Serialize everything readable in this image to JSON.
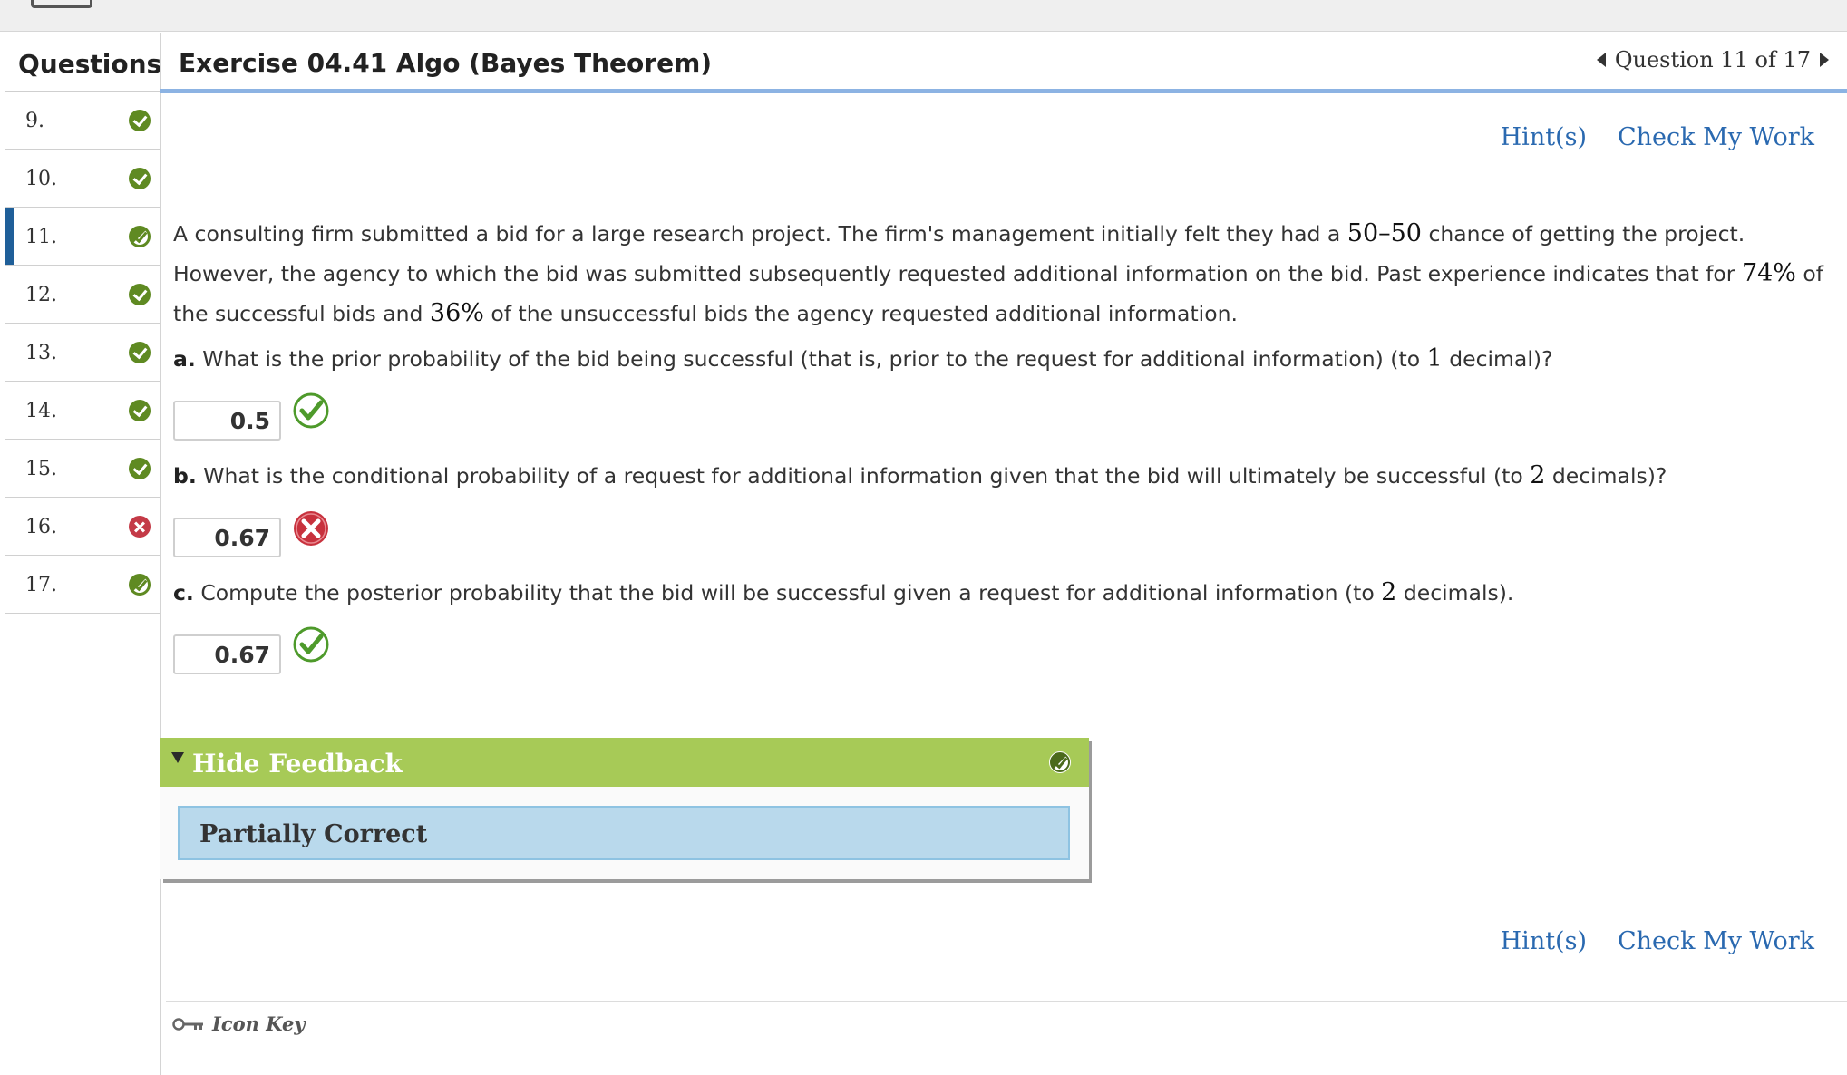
{
  "sidebar": {
    "header": "Questions",
    "items": [
      {
        "num": "9.",
        "status": "correct"
      },
      {
        "num": "10.",
        "status": "correct"
      },
      {
        "num": "11.",
        "status": "partial"
      },
      {
        "num": "12.",
        "status": "correct"
      },
      {
        "num": "13.",
        "status": "correct"
      },
      {
        "num": "14.",
        "status": "correct"
      },
      {
        "num": "15.",
        "status": "correct"
      },
      {
        "num": "16.",
        "status": "incorrect"
      },
      {
        "num": "17.",
        "status": "partial"
      }
    ]
  },
  "header": {
    "title": "Exercise 04.41 Algo (Bayes Theorem)",
    "question_nav": "Question 11 of 17"
  },
  "links": {
    "hints": "Hint(s)",
    "check": "Check My Work"
  },
  "problem": {
    "text1": "A consulting firm submitted a bid for a large research project. The firm's management initially felt they had a ",
    "n5050": "50–50",
    "text2": " chance of getting the project. However, the agency to which the bid was submitted subsequently requested additional information on the bid. Past experience indicates that for ",
    "p74": "74%",
    "text3": " of the successful bids and ",
    "p36": "36%",
    "text4": " of the unsuccessful bids the agency requested additional information."
  },
  "parts": [
    {
      "label": "a.",
      "pre": " What is the prior probability of the bid being successful (that is, prior to the request for additional information) (to ",
      "num": "1",
      "post": " decimal)?",
      "answer": "0.5",
      "result": "correct"
    },
    {
      "label": "b.",
      "pre": " What is the conditional probability of a request for additional information given that the bid will ultimately be successful (to ",
      "num": "2",
      "post": " decimals)?",
      "answer": "0.67",
      "result": "incorrect"
    },
    {
      "label": "c.",
      "pre": " Compute the posterior probability that the bid will be successful given a request for additional information (to ",
      "num": "2",
      "post": " decimals).",
      "answer": "0.67",
      "result": "correct"
    }
  ],
  "feedback": {
    "toggle": "Hide Feedback",
    "status": "Partially Correct"
  },
  "footer": {
    "icon_key": "Icon Key"
  },
  "colors": {
    "correct": "#5f8a22",
    "incorrect": "#c43a47",
    "link": "#2a69b0",
    "active_bar": "#1f5f99",
    "feedback_header": "#a7ca57",
    "feedback_body": "#b9d9ec"
  }
}
